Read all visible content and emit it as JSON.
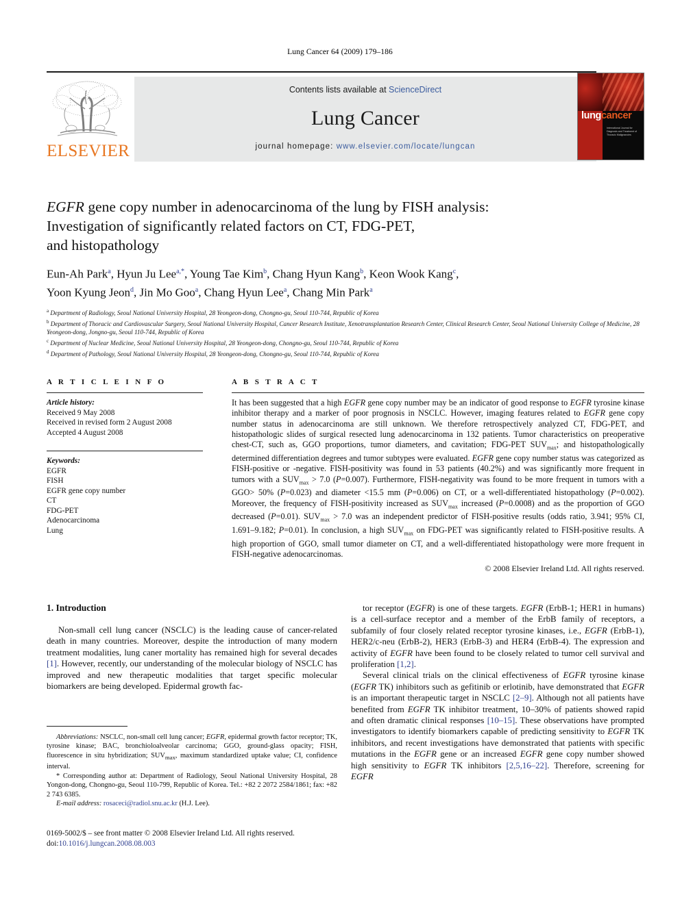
{
  "running_head": "Lung Cancer 64 (2009) 179–186",
  "masthead": {
    "contents_prefix": "Contents lists available at ",
    "sciencedirect": "ScienceDirect",
    "journal_title": "Lung Cancer",
    "homepage_label": "journal homepage:",
    "homepage_url": "www.elsevier.com/locate/lungcan",
    "publisher_wordmark": "ELSEVIER",
    "publisher_color": "#e87722",
    "link_color": "#3b5c9e"
  },
  "cover": {
    "word_lung": "lung",
    "word_cancer": "cancer",
    "subtitle": "International Journal for Diagnosis and Treatment of Thoracic Malignancies"
  },
  "article": {
    "title_line1_italic": "EGFR",
    "title_line1_rest": " gene copy number in adenocarcinoma of the lung by FISH analysis:",
    "title_line2": "Investigation of significantly related factors on CT, FDG-PET,",
    "title_line3": "and histopathology",
    "authors_line1": "Eun-Ah Park<sup>a</sup>, Hyun Ju Lee<sup>a,*</sup>, Young Tae Kim<sup>b</sup>, Chang Hyun Kang<sup>b</sup>, Keon Wook Kang<sup>c</sup>,",
    "authors_line2": "Yoon Kyung Jeon<sup>d</sup>, Jin Mo Goo<sup>a</sup>, Chang Hyun Lee<sup>a</sup>, Chang Min Park<sup>a</sup>",
    "affiliations": [
      "<sup>a</sup> Department of Radiology, Seoul National University Hospital, 28 Yeongeon-dong, Chongno-gu, Seoul 110-744, Republic of Korea",
      "<sup>b</sup> Department of Thoracic and Cardiovascular Surgery, Seoul National University Hospital, Cancer Research Institute, Xenotransplantation Research Center, Clinical Research Center, Seoul National University College of Medicine, 28 Yeongeon-dong, Jongno-gu, Seoul 110-744, Republic of Korea",
      "<sup>c</sup> Department of Nuclear Medicine, Seoul National University Hospital, 28 Yeongeon-dong, Chongno-gu, Seoul 110-744, Republic of Korea",
      "<sup>d</sup> Department of Pathology, Seoul National University Hospital, 28 Yeongeon-dong, Chongno-gu, Seoul 110-744, Republic of Korea"
    ]
  },
  "article_info": {
    "heading": "A R T I C L E   I N F O",
    "history_label": "Article history:",
    "history": [
      "Received 9 May 2008",
      "Received in revised form 2 August 2008",
      "Accepted 4 August 2008"
    ],
    "keywords_label": "Keywords:",
    "keywords": [
      "EGFR",
      "FISH",
      "EGFR gene copy number",
      "CT",
      "FDG-PET",
      "Adenocarcinoma",
      "Lung"
    ]
  },
  "abstract": {
    "heading": "A B S T R A C T",
    "text": "It has been suggested that a high <em>EGFR</em> gene copy number may be an indicator of good response to <em>EGFR</em> tyrosine kinase inhibitor therapy and a marker of poor prognosis in NSCLC. However, imaging features related to <em>EGFR</em> gene copy number status in adenocarcinoma are still unknown. We therefore retrospectively analyzed CT, FDG-PET, and histopathologic slides of surgical resected lung adenocarcinoma in 132 patients. Tumor characteristics on preoperative chest-CT, such as, GGO proportions, tumor diameters, and cavitation; FDG-PET SUV<sub>max</sub>; and histopathologically determined differentiation degrees and tumor subtypes were evaluated. <em>EGFR</em> gene copy number status was categorized as FISH-positive or -negative. FISH-positivity was found in 53 patients (40.2%) and was significantly more frequent in tumors with a SUV<sub>max</sub> &gt; 7.0 (<em>P</em>=0.007). Furthermore, FISH-negativity was found to be more frequent in tumors with a GGO&gt; 50% (<em>P</em>=0.023) and diameter &lt;15.5 mm (<em>P</em>=0.006) on CT, or a well-differentiated histopathology (<em>P</em>=0.002). Moreover, the frequency of FISH-positivity increased as SUV<sub>max</sub> increased (<em>P</em>=0.0008) and as the proportion of GGO decreased (<em>P</em>=0.01). SUV<sub>max</sub> &gt; 7.0 was an independent predictor of FISH-positive results (odds ratio, 3.941; 95% CI, 1.691–9.182; <em>P</em>=0.01). In conclusion, a high SUV<sub>max</sub> on FDG-PET was significantly related to FISH-positive results. A high proportion of GGO, small tumor diameter on CT, and a well-differentiated histopathology were more frequent in FISH-negative adenocarcinomas.",
    "copyright": "© 2008 Elsevier Ireland Ltd. All rights reserved."
  },
  "introduction": {
    "heading": "1. Introduction",
    "left_para": "Non-small cell lung cancer (NSCLC) is the leading cause of cancer-related death in many countries. Moreover, despite the introduction of many modern treatment modalities, lung caner mortality has remained high for several decades <span class=\"ref\">[1]</span>. However, recently, our understanding of the molecular biology of NSCLC has improved and new therapeutic modalities that target specific molecular biomarkers are being developed. Epidermal growth fac-",
    "right_para_1": "tor receptor (<em>EGFR</em>) is one of these targets. <em>EGFR</em> (ErbB-1; HER1 in humans) is a cell-surface receptor and a member of the ErbB family of receptors, a subfamily of four closely related receptor tyrosine kinases, i.e., <em>EGFR</em> (ErbB-1), HER2/c-neu (ErbB-2), HER3 (ErbB-3) and HER4 (ErbB-4). The expression and activity of <em>EGFR</em> have been found to be closely related to tumor cell survival and proliferation <span class=\"ref\">[1,2]</span>.",
    "right_para_2": "Several clinical trials on the clinical effectiveness of <em>EGFR</em> tyrosine kinase (<em>EGFR</em> TK) inhibitors such as gefitinib or erlotinib, have demonstrated that <em>EGFR</em> is an important therapeutic target in NSCLC <span class=\"ref\">[2–9]</span>. Although not all patients have benefited from <em>EGFR</em> TK inhibitor treatment, 10–30% of patients showed rapid and often dramatic clinical responses <span class=\"ref\">[10–15]</span>. These observations have prompted investigators to identify biomarkers capable of predicting sensitivity to <em>EGFR</em> TK inhibitors, and recent investigations have demonstrated that patients with specific mutations in the <em>EGFR</em> gene or an increased <em>EGFR</em> gene copy number showed high sensitivity to <em>EGFR</em> TK inhibitors <span class=\"ref\">[2,5,16–22]</span>. Therefore, screening for <em>EGFR</em>"
  },
  "footnotes": {
    "abbreviations": "<em>Abbreviations:</em> NSCLC, non-small cell lung cancer; <em>EGFR</em>, epidermal growth factor receptor; TK, tyrosine kinase; BAC, bronchioloalveolar carcinoma; GGO, ground-glass opacity; FISH, fluorescence in situ hybridization; SUV<sub>max</sub>, maximum standardized uptake value; CI, confidence interval.",
    "corresponding": "* Corresponding author at: Department of Radiology, Seoul National University Hospital, 28 Yongon-dong, Chongno-gu, Seoul 110-799, Republic of Korea. Tel.: +82 2 2072 2584/1861; fax: +82 2 743 6385.",
    "email_label": "E-mail address:",
    "email": "rosaceci@radiol.snu.ac.kr",
    "email_suffix": " (H.J. Lee)."
  },
  "imprint": {
    "line1": "0169-5002/$ – see front matter © 2008 Elsevier Ireland Ltd. All rights reserved.",
    "doi_label": "doi:",
    "doi": "10.1016/j.lungcan.2008.08.003"
  }
}
